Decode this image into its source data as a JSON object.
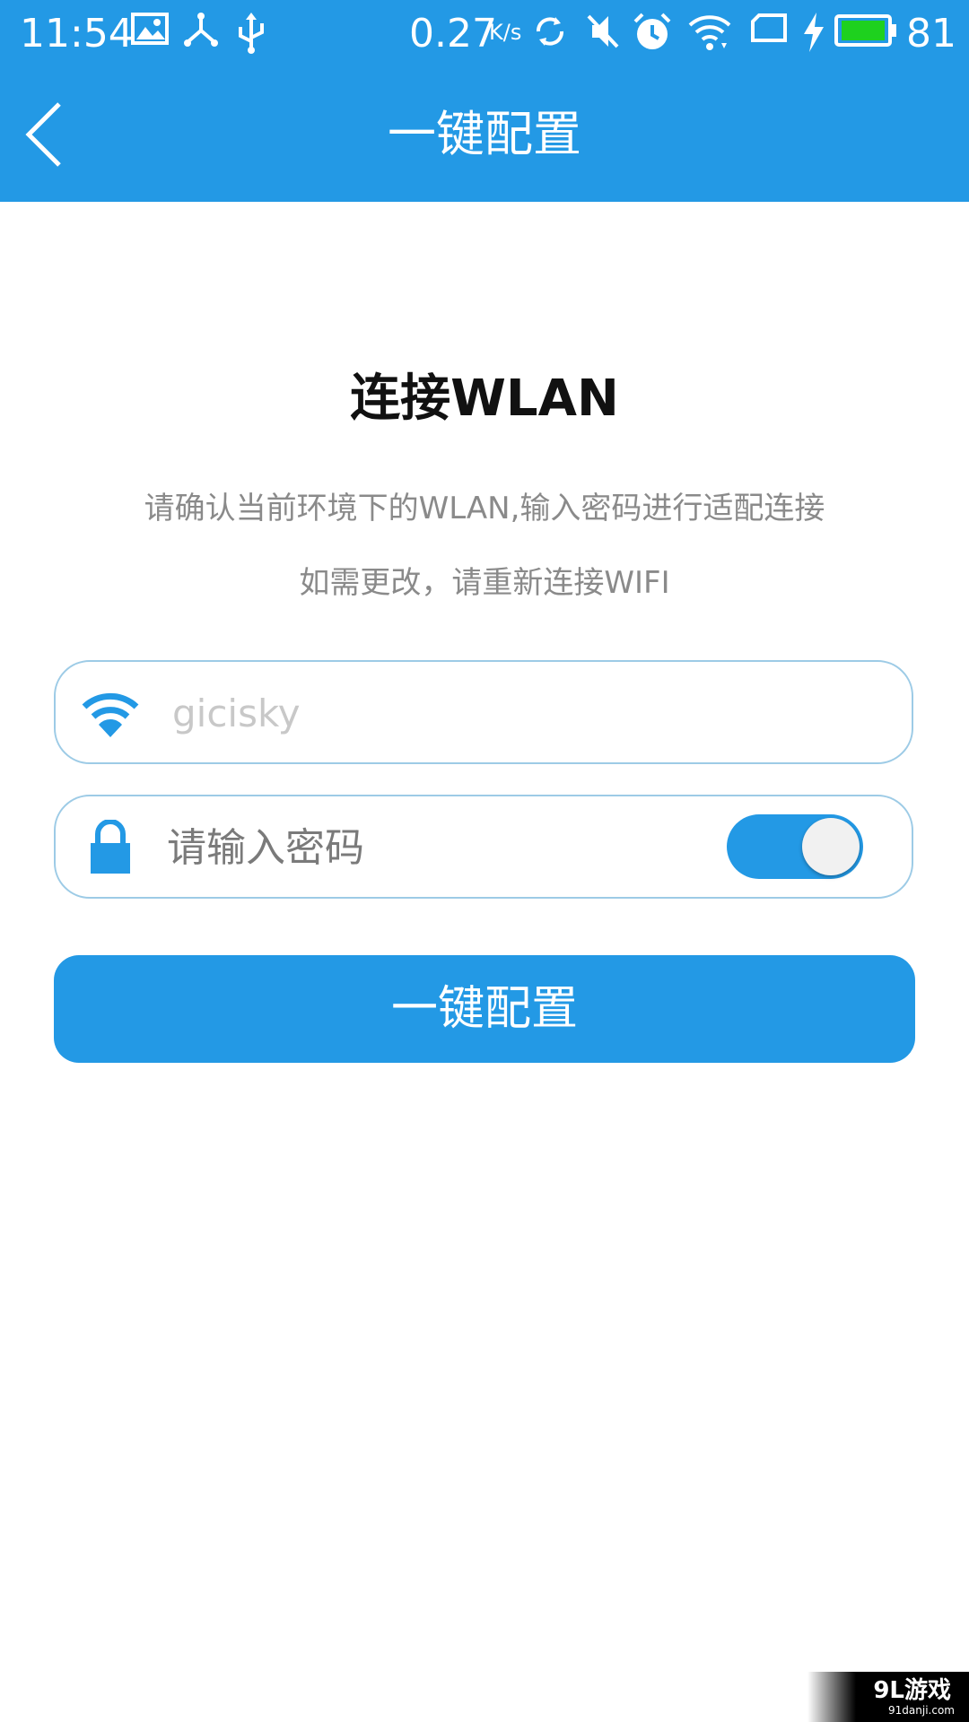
{
  "status_bar": {
    "time": "11:54",
    "net_speed": "0.27",
    "net_speed_unit": "K/s",
    "battery_level": "81",
    "icons": [
      "image-icon",
      "share-icon",
      "usb-icon",
      "sync-icon",
      "mute-icon",
      "alarm-icon",
      "wifi-icon",
      "sim-icon",
      "charging-icon",
      "battery-icon"
    ]
  },
  "app_bar": {
    "title": "一键配置",
    "back_icon": "back-icon"
  },
  "main": {
    "heading": "连接WLAN",
    "desc_line1": "请确认当前环境下的WLAN,输入密码进行适配连接",
    "desc_line2": "如需更改，请重新连接WIFI",
    "ssid_field": {
      "icon": "wifi-icon",
      "placeholder": "gicisky"
    },
    "password_field": {
      "icon": "lock-icon",
      "placeholder": "请输入密码",
      "toggle_on": true
    },
    "config_button": "一键配置"
  },
  "watermark": {
    "logo_text": "9L游戏",
    "url_text": "91danji.com"
  },
  "colors": {
    "primary": "#2399e5",
    "field_border": "#9dcbe6",
    "hint_text": "#8a8a8a"
  }
}
